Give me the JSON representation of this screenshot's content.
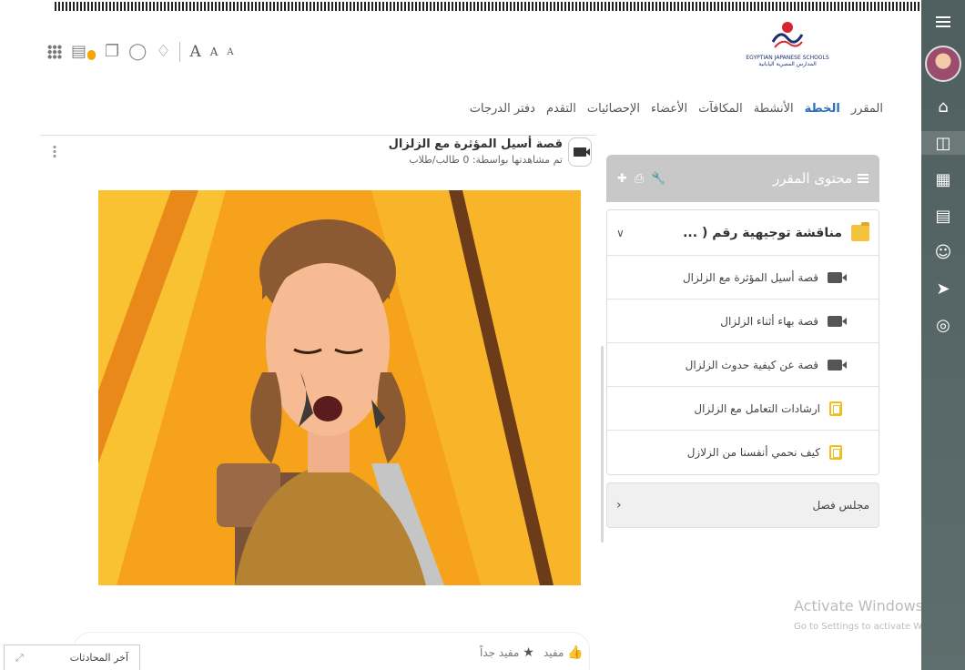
{
  "header": {
    "font_sizes": [
      "A",
      "A",
      "A"
    ],
    "logo_caption": [
      "EGYPTIAN JAPANESE SCHOOLS",
      "المدارس المصرية اليابانية"
    ]
  },
  "tabs": [
    {
      "label": "المقرر",
      "active": false
    },
    {
      "label": "الخطة",
      "active": true
    },
    {
      "label": "الأنشطة",
      "active": false
    },
    {
      "label": "المكافآت",
      "active": false
    },
    {
      "label": "الأعضاء",
      "active": false
    },
    {
      "label": "الإحصائيات",
      "active": false
    },
    {
      "label": "التقدم",
      "active": false
    },
    {
      "label": "دفتر الدرجات",
      "active": false
    }
  ],
  "video": {
    "title": "قصة أسيل المؤثرة مع الزلزال",
    "subtitle": "تم مشاهدتها بواسطة: 0 طالب/طلاب"
  },
  "course": {
    "title": "محتوى المقرر",
    "unit": {
      "title": "مناقشة توجيهية رقم ( ...",
      "items": [
        {
          "label": "قصة أسيل المؤثرة مع الزلزال",
          "icon": "video-icon"
        },
        {
          "label": "قصة بهاء أثناء الزلزال",
          "icon": "video-icon"
        },
        {
          "label": "قصة عن كيفية حدوث الزلزال",
          "icon": "video-icon"
        },
        {
          "label": "ارشادات التعامل مع الزلزال",
          "icon": "document-icon"
        },
        {
          "label": "كيف نحمي أنفسنا من الزلازل",
          "icon": "document-icon"
        }
      ]
    },
    "council_label": "مجلس فصل"
  },
  "watermark": {
    "line1": "Activate Windows",
    "line2": "Go to Settings to activate Windows."
  },
  "reactions": {
    "useful": "مفيد",
    "very_useful": "مفيد جداً"
  },
  "chats": {
    "label": "آخر المحادثات"
  },
  "colors": {
    "active_tab": "#2a6ebd",
    "sidebar": "#566666",
    "folder": "#f4c33b",
    "course_header": "#c8c8c8"
  }
}
